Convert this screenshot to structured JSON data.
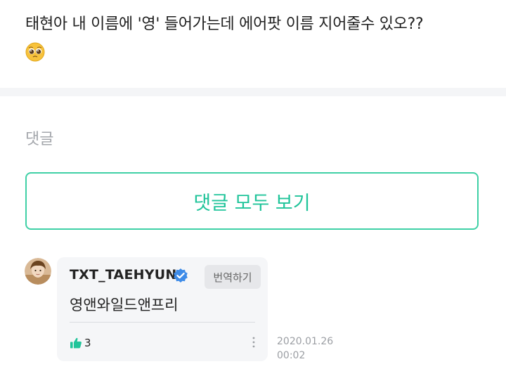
{
  "post": {
    "text": "태현아 내 이름에 '영' 들어가는데 에어팟 이름 지어줄수 있오??",
    "emoji_icon": "pleading-face-icon"
  },
  "comments_section": {
    "label": "댓글",
    "view_all_label": "댓글 모두 보기",
    "accent_color": "#20c49a"
  },
  "comment": {
    "username": "TXT_TAEHYUN",
    "verified_icon": "verified-badge-icon",
    "translate_label": "번역하기",
    "body": "영앤와일드앤프리",
    "like_count": "3",
    "date": "2020.01.26",
    "time": "00:02"
  }
}
